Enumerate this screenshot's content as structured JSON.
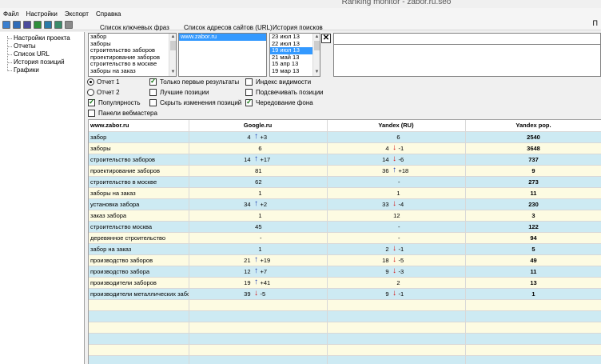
{
  "window": {
    "title": "Ranking monitor - zabor.ru.seo"
  },
  "menu": [
    "Файл",
    "Настройки",
    "Экспорт",
    "Справка"
  ],
  "toolbar_right": "П",
  "sidebar": {
    "items": [
      "Настройки проекта",
      "Отчеты",
      "Список URL",
      "История позиций",
      "Графики"
    ]
  },
  "panels": {
    "keywords_label": "Список ключевых фраз",
    "urls_label": "Список адресов сайтов (URL)",
    "history_label": "История поисков",
    "keywords": [
      "забор",
      "заборы",
      "строительство заборов",
      "проектирование заборов",
      "строительство в москве",
      "заборы на заказ"
    ],
    "urls": [
      "www.zabor.ru"
    ],
    "history": [
      "23 июл 13",
      "22 июл 13",
      "19 июл 13",
      "21 май 13",
      "15 апр 13",
      "19 мар 13"
    ],
    "history_selected": 2
  },
  "options": {
    "report1": "Отчет 1",
    "report2": "Отчет 2",
    "popularity": "Популярность",
    "webmaster": "Панели вебмастера",
    "first_results": "Только первые результаты",
    "best_positions": "Лучшие позиции",
    "hide_changes": "Скрыть изменения позиций",
    "visibility": "Индекс видимости",
    "highlight": "Подсвечивать позиции",
    "alternate_bg": "Чередование фона"
  },
  "table": {
    "headers": [
      "www.zabor.ru",
      "Google.ru",
      "Yandex (RU)",
      "Yandex pop."
    ],
    "rows": [
      {
        "kw": "забор",
        "g": "4",
        "g_dir": "up",
        "g_delta": "+3",
        "y": "6",
        "y_dir": "",
        "y_delta": "",
        "pop": "2540"
      },
      {
        "kw": "заборы",
        "g": "6",
        "g_dir": "",
        "g_delta": "",
        "y": "4",
        "y_dir": "down",
        "y_delta": "-1",
        "pop": "3648"
      },
      {
        "kw": "строительство заборов",
        "g": "14",
        "g_dir": "up",
        "g_delta": "+17",
        "y": "14",
        "y_dir": "down",
        "y_delta": "-6",
        "pop": "737"
      },
      {
        "kw": "проектирование заборов",
        "g": "81",
        "g_dir": "",
        "g_delta": "",
        "y": "36",
        "y_dir": "up",
        "y_delta": "+18",
        "pop": "9"
      },
      {
        "kw": "строительство в москве",
        "g": "62",
        "g_dir": "",
        "g_delta": "",
        "y": "-",
        "y_dir": "",
        "y_delta": "",
        "pop": "273"
      },
      {
        "kw": "заборы на заказ",
        "g": "1",
        "g_dir": "",
        "g_delta": "",
        "y": "1",
        "y_dir": "",
        "y_delta": "",
        "pop": "11"
      },
      {
        "kw": "установка забора",
        "g": "34",
        "g_dir": "up",
        "g_delta": "+2",
        "y": "33",
        "y_dir": "down",
        "y_delta": "-4",
        "pop": "230"
      },
      {
        "kw": "заказ забора",
        "g": "1",
        "g_dir": "",
        "g_delta": "",
        "y": "12",
        "y_dir": "",
        "y_delta": "",
        "pop": "3"
      },
      {
        "kw": "строительство москва",
        "g": "45",
        "g_dir": "",
        "g_delta": "",
        "y": "-",
        "y_dir": "",
        "y_delta": "",
        "pop": "122"
      },
      {
        "kw": "деревянное строительство",
        "g": "-",
        "g_dir": "",
        "g_delta": "",
        "y": "-",
        "y_dir": "",
        "y_delta": "",
        "pop": "94"
      },
      {
        "kw": "забор на заказ",
        "g": "1",
        "g_dir": "",
        "g_delta": "",
        "y": "2",
        "y_dir": "down",
        "y_delta": "-1",
        "pop": "5"
      },
      {
        "kw": "производство заборов",
        "g": "21",
        "g_dir": "up",
        "g_delta": "+19",
        "y": "18",
        "y_dir": "down",
        "y_delta": "-5",
        "pop": "49"
      },
      {
        "kw": "производство забора",
        "g": "12",
        "g_dir": "up",
        "g_delta": "+7",
        "y": "9",
        "y_dir": "down",
        "y_delta": "-3",
        "pop": "11"
      },
      {
        "kw": "производители заборов",
        "g": "19",
        "g_dir": "up",
        "g_delta": "+41",
        "y": "2",
        "y_dir": "",
        "y_delta": "",
        "pop": "13"
      },
      {
        "kw": "производители металлических забо",
        "g": "39",
        "g_dir": "down",
        "g_delta": "-5",
        "y": "9",
        "y_dir": "down",
        "y_delta": "-1",
        "pop": "1"
      }
    ],
    "empty_rows": 6
  },
  "colors": {
    "row_even": "#cdeaf3",
    "row_odd": "#fdfbe2",
    "up_arrow": "#1d3fb2",
    "down_arrow": "#d31414",
    "selection": "#3399ff"
  }
}
